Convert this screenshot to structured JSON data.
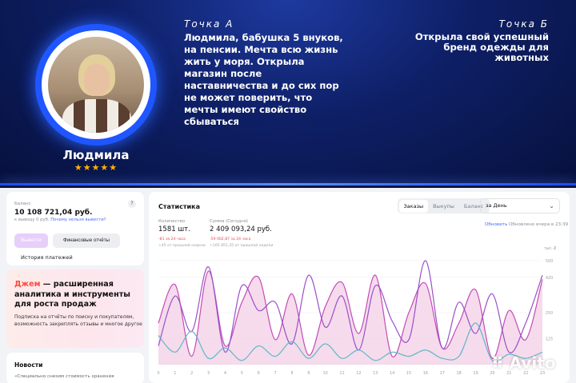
{
  "banner": {
    "person_name": "Людмила",
    "stars": "★★★★★",
    "point_a_label": "Точка А",
    "point_a_text": "Людмила, бабушка 5 внуков, на пенсии. Мечта всю жизнь жить у моря. Открыла магазин после наставничества и до сих пор не может поверить, что мечты имеют свойство сбываться",
    "point_b_label": "Точка Б",
    "point_b_text": "Открыла свой успешный бренд одежды для животных",
    "accent_color": "#1f56ff"
  },
  "balance": {
    "label": "Баланс",
    "help_icon": "?",
    "amount": "10 108 721,04 руб.",
    "sub_text": "к выводу 0 руб.",
    "sub_link": "Почему нельзя вывести?",
    "withdraw_label": "Вывести",
    "reports_label": "Финансовые отчёты",
    "history_label": "История платежей"
  },
  "promo": {
    "accent": "Джем",
    "title_rest": " — расширенная аналитика и инструменты для роста продаж",
    "description": "Подписка на отчёты по поиску и покупателям, возможность закреплять отзывы и многое другое"
  },
  "news": {
    "title": "Новости",
    "item": "«Специально снизим стоимость хранения"
  },
  "stats": {
    "title": "Статистика",
    "tabs": [
      "Заказы",
      "Выкупы",
      "Баланс"
    ],
    "active_tab": "Заказы",
    "period": "за День",
    "refresh_label": "Обновить",
    "updated_text": "Обновлено вчера в 23:39",
    "kpi_qty_label": "Количество",
    "kpi_qty_value": "1581 шт.",
    "kpi_qty_delta1": "-81 за 24 часа",
    "kpi_qty_delta2": "+45 от прошлой недели",
    "kpi_sum_label": "Сумма (Сегодня)",
    "kpi_sum_value": "2 409 093,24 руб.",
    "kpi_sum_delta1": "-59 002,87 за 24 часа",
    "kpi_sum_delta2": "+105 851,35 от прошлой недели"
  },
  "chart_data": {
    "type": "area",
    "unit_label": "тыс. ₽",
    "y_ticks": [
      "500",
      "420",
      "250",
      "125",
      "0"
    ],
    "x": [
      "0",
      "1",
      "2",
      "3",
      "4",
      "5",
      "6",
      "7",
      "8",
      "9",
      "10",
      "11",
      "12",
      "13",
      "14",
      "15",
      "16",
      "17",
      "18",
      "19",
      "20",
      "21",
      "22",
      "23"
    ],
    "ylim": [
      0,
      500
    ],
    "series": [
      {
        "color": "#c54bb5",
        "fill": "#f2cfe6",
        "values": [
          200,
          385,
          40,
          450,
          90,
          300,
          420,
          120,
          340,
          45,
          280,
          395,
          150,
          430,
          40,
          250,
          390,
          80,
          200,
          360,
          30,
          260,
          120,
          410
        ]
      },
      {
        "color": "#9a50c9",
        "fill": "none",
        "values": [
          90,
          330,
          160,
          470,
          60,
          380,
          260,
          300,
          100,
          430,
          180,
          330,
          70,
          380,
          210,
          120,
          500,
          80,
          300,
          150,
          340,
          60,
          200,
          430
        ]
      },
      {
        "color": "#5fb8c8",
        "fill": "none",
        "values": [
          140,
          60,
          160,
          30,
          80,
          20,
          90,
          40,
          110,
          30,
          100,
          30,
          70,
          20,
          60,
          40,
          70,
          30,
          40,
          200,
          20,
          50,
          30,
          60
        ]
      }
    ]
  },
  "watermark": {
    "text": "Avito"
  }
}
